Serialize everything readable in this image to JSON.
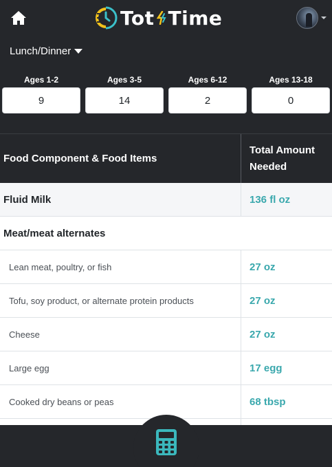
{
  "header": {
    "brand_left": "Tot",
    "brand_right": "Time",
    "home_icon": "home-icon",
    "avatar_icon": "user-avatar"
  },
  "meal": {
    "selected": "Lunch/Dinner"
  },
  "ages": [
    {
      "label": "Ages 1-2",
      "value": "9"
    },
    {
      "label": "Ages 3-5",
      "value": "14"
    },
    {
      "label": "Ages 6-12",
      "value": "2"
    },
    {
      "label": "Ages 13-18",
      "value": "0"
    }
  ],
  "table": {
    "header_component": "Food Component & Food Items",
    "header_amount_line1": "Total Amount",
    "header_amount_line2": "Needed",
    "rows": [
      {
        "name": "Fluid Milk",
        "amount": "136 fl oz"
      },
      {
        "name": "Meat/meat alternates",
        "amount": ""
      },
      {
        "name": "Lean meat, poultry, or fish",
        "amount": "27 oz"
      },
      {
        "name": "Tofu, soy product, or alternate protein products",
        "amount": "27 oz"
      },
      {
        "name": "Cheese",
        "amount": "27 oz"
      },
      {
        "name": "Large egg",
        "amount": "17 egg"
      },
      {
        "name": "Cooked dry beans or peas",
        "amount": "68 tbsp"
      }
    ]
  },
  "colors": {
    "background": "#25272b",
    "accent_teal": "#3aa8ad",
    "accent_yellow": "#f2c21b"
  },
  "footer": {
    "calculator_icon": "calculator-icon"
  }
}
